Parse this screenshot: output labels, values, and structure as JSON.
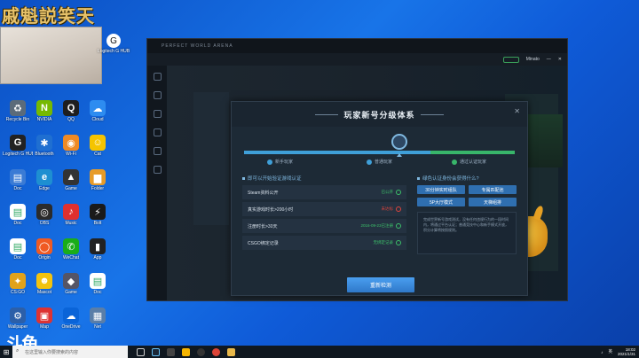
{
  "overlay": {
    "banner_text": "戚魁説笑天"
  },
  "desktop": {
    "steam_label": "Logitech G HUB",
    "icons": [
      {
        "label": "Recycle Bin",
        "color": "#5b6b7a",
        "glyph": "♻"
      },
      {
        "label": "NVIDIA",
        "color": "#76b900",
        "glyph": "N"
      },
      {
        "label": "QQ",
        "color": "#1e1e1e",
        "glyph": "Q"
      },
      {
        "label": "Cloud",
        "color": "#2d8cf0",
        "glyph": "☁"
      },
      {
        "label": "Logitech G HUB",
        "color": "#222",
        "glyph": "G"
      },
      {
        "label": "Bluetooth",
        "color": "#1f6fd1",
        "glyph": "✱"
      },
      {
        "label": "Wi-Fi",
        "color": "#f08a24",
        "glyph": "◉"
      },
      {
        "label": "Cat",
        "color": "#f5c400",
        "glyph": "☺"
      },
      {
        "label": "Doc",
        "color": "#3a7bd5",
        "glyph": "▤"
      },
      {
        "label": "Edge",
        "color": "#1e8fd1",
        "glyph": "e"
      },
      {
        "label": "Game",
        "color": "#333",
        "glyph": "▲"
      },
      {
        "label": "Folder",
        "color": "#e79b28",
        "glyph": "▆"
      },
      {
        "label": "Doc",
        "color": "#fff",
        "glyph": "▤"
      },
      {
        "label": "OBS",
        "color": "#2b2b2b",
        "glyph": "◎"
      },
      {
        "label": "Music",
        "color": "#e0302f",
        "glyph": "♪"
      },
      {
        "label": "Bolt",
        "color": "#1a1a1a",
        "glyph": "⚡"
      },
      {
        "label": "Doc",
        "color": "#fff",
        "glyph": "▤"
      },
      {
        "label": "Origin",
        "color": "#f05a22",
        "glyph": "◯"
      },
      {
        "label": "WeChat",
        "color": "#1aad19",
        "glyph": "✆"
      },
      {
        "label": "App",
        "color": "#222",
        "glyph": "▮"
      },
      {
        "label": "CS:GO",
        "color": "#e1a21b",
        "glyph": "✦"
      },
      {
        "label": "Mascot",
        "color": "#f2c30f",
        "glyph": "☻"
      },
      {
        "label": "Game",
        "color": "#556",
        "glyph": "◆"
      },
      {
        "label": "Doc",
        "color": "#fff",
        "glyph": "▤"
      },
      {
        "label": "Wallpaper",
        "color": "#2c5fa8",
        "glyph": "⚙"
      },
      {
        "label": "Map",
        "color": "#d33",
        "glyph": "▣"
      },
      {
        "label": "OneDrive",
        "color": "#0a64d8",
        "glyph": "☁"
      },
      {
        "label": "Net",
        "color": "#5a7ea8",
        "glyph": "▦"
      }
    ]
  },
  "app": {
    "brand": "PERFECT WORLD ARENA",
    "toolbar_user": "Minato"
  },
  "modal": {
    "title": "玩家新号分级体系",
    "close": "✕",
    "steps": [
      "新手玩家",
      "普通玩家",
      "通过认证玩家"
    ],
    "left_heading": "即可以开始验证游戏认证",
    "requirements": [
      {
        "name": "Steam资料公开",
        "status": "已公开",
        "ok": true
      },
      {
        "name": "真实游戏时长>200小时",
        "status": "未达标",
        "ok": false
      },
      {
        "name": "注册时长>30天",
        "status": "2016-09-23已注册",
        "ok": true
      },
      {
        "name": "CSGO绑定记录",
        "status": "无绑定记录",
        "ok": true
      }
    ],
    "right_heading": "绿色认证身份会获得什么?",
    "options": [
      "30分钟实时组队",
      "专属匹配池",
      "5P大厅模式",
      "天梯组排"
    ],
    "info": "完成世界新号游戏测试，没有任何违规行为的一段时间内，将通过平台认证；普通竞技中心和新手模式开放，积分计算将按照规则。",
    "retest_button": "重新检测"
  },
  "taskbar": {
    "search_placeholder": "在这里输入你要搜索的内容",
    "time": "18:02",
    "date": "2021/1/31",
    "lang": "英"
  }
}
